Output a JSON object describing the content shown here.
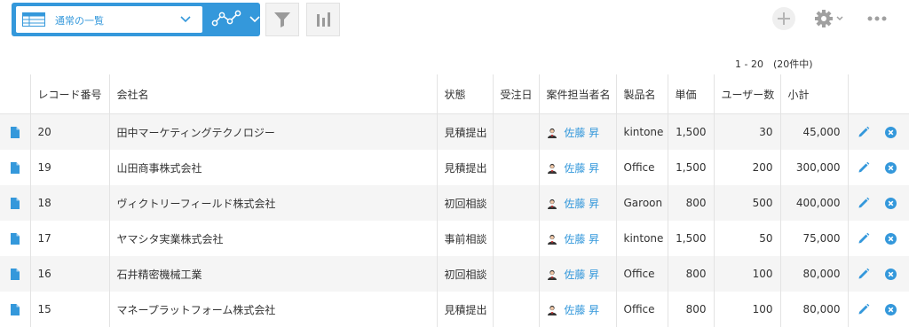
{
  "toolbar": {
    "view_name": "通常の一覧",
    "icons": [
      "list-view-icon",
      "chevron-down-icon",
      "graph-icon",
      "filter-icon",
      "bar-chart-icon",
      "add-icon",
      "gear-icon",
      "more-icon"
    ],
    "accent": "#3498db"
  },
  "pager": "1 - 20　(20件中)",
  "columns": [
    "レコード番号",
    "会社名",
    "状態",
    "受注日",
    "案件担当者名",
    "製品名",
    "単価",
    "ユーザー数",
    "小計"
  ],
  "rows": [
    {
      "no": "20",
      "company": "田中マーケティングテクノロジー",
      "status": "見積提出",
      "date": "",
      "owner": "佐藤 昇",
      "product": "kintone",
      "price": "1,500",
      "users": "30",
      "subtotal": "45,000"
    },
    {
      "no": "19",
      "company": "山田商事株式会社",
      "status": "見積提出",
      "date": "",
      "owner": "佐藤 昇",
      "product": "Office",
      "price": "1,500",
      "users": "200",
      "subtotal": "300,000"
    },
    {
      "no": "18",
      "company": "ヴィクトリーフィールド株式会社",
      "status": "初回相談",
      "date": "",
      "owner": "佐藤 昇",
      "product": "Garoon",
      "price": "800",
      "users": "500",
      "subtotal": "400,000"
    },
    {
      "no": "17",
      "company": "ヤマシタ実業株式会社",
      "status": "事前相談",
      "date": "",
      "owner": "佐藤 昇",
      "product": "kintone",
      "price": "1,500",
      "users": "50",
      "subtotal": "75,000"
    },
    {
      "no": "16",
      "company": "石井精密機械工業",
      "status": "初回相談",
      "date": "",
      "owner": "佐藤 昇",
      "product": "Office",
      "price": "800",
      "users": "100",
      "subtotal": "80,000"
    },
    {
      "no": "15",
      "company": "マネープラットフォーム株式会社",
      "status": "見積提出",
      "date": "",
      "owner": "佐藤 昇",
      "product": "Office",
      "price": "800",
      "users": "100",
      "subtotal": "80,000"
    }
  ]
}
